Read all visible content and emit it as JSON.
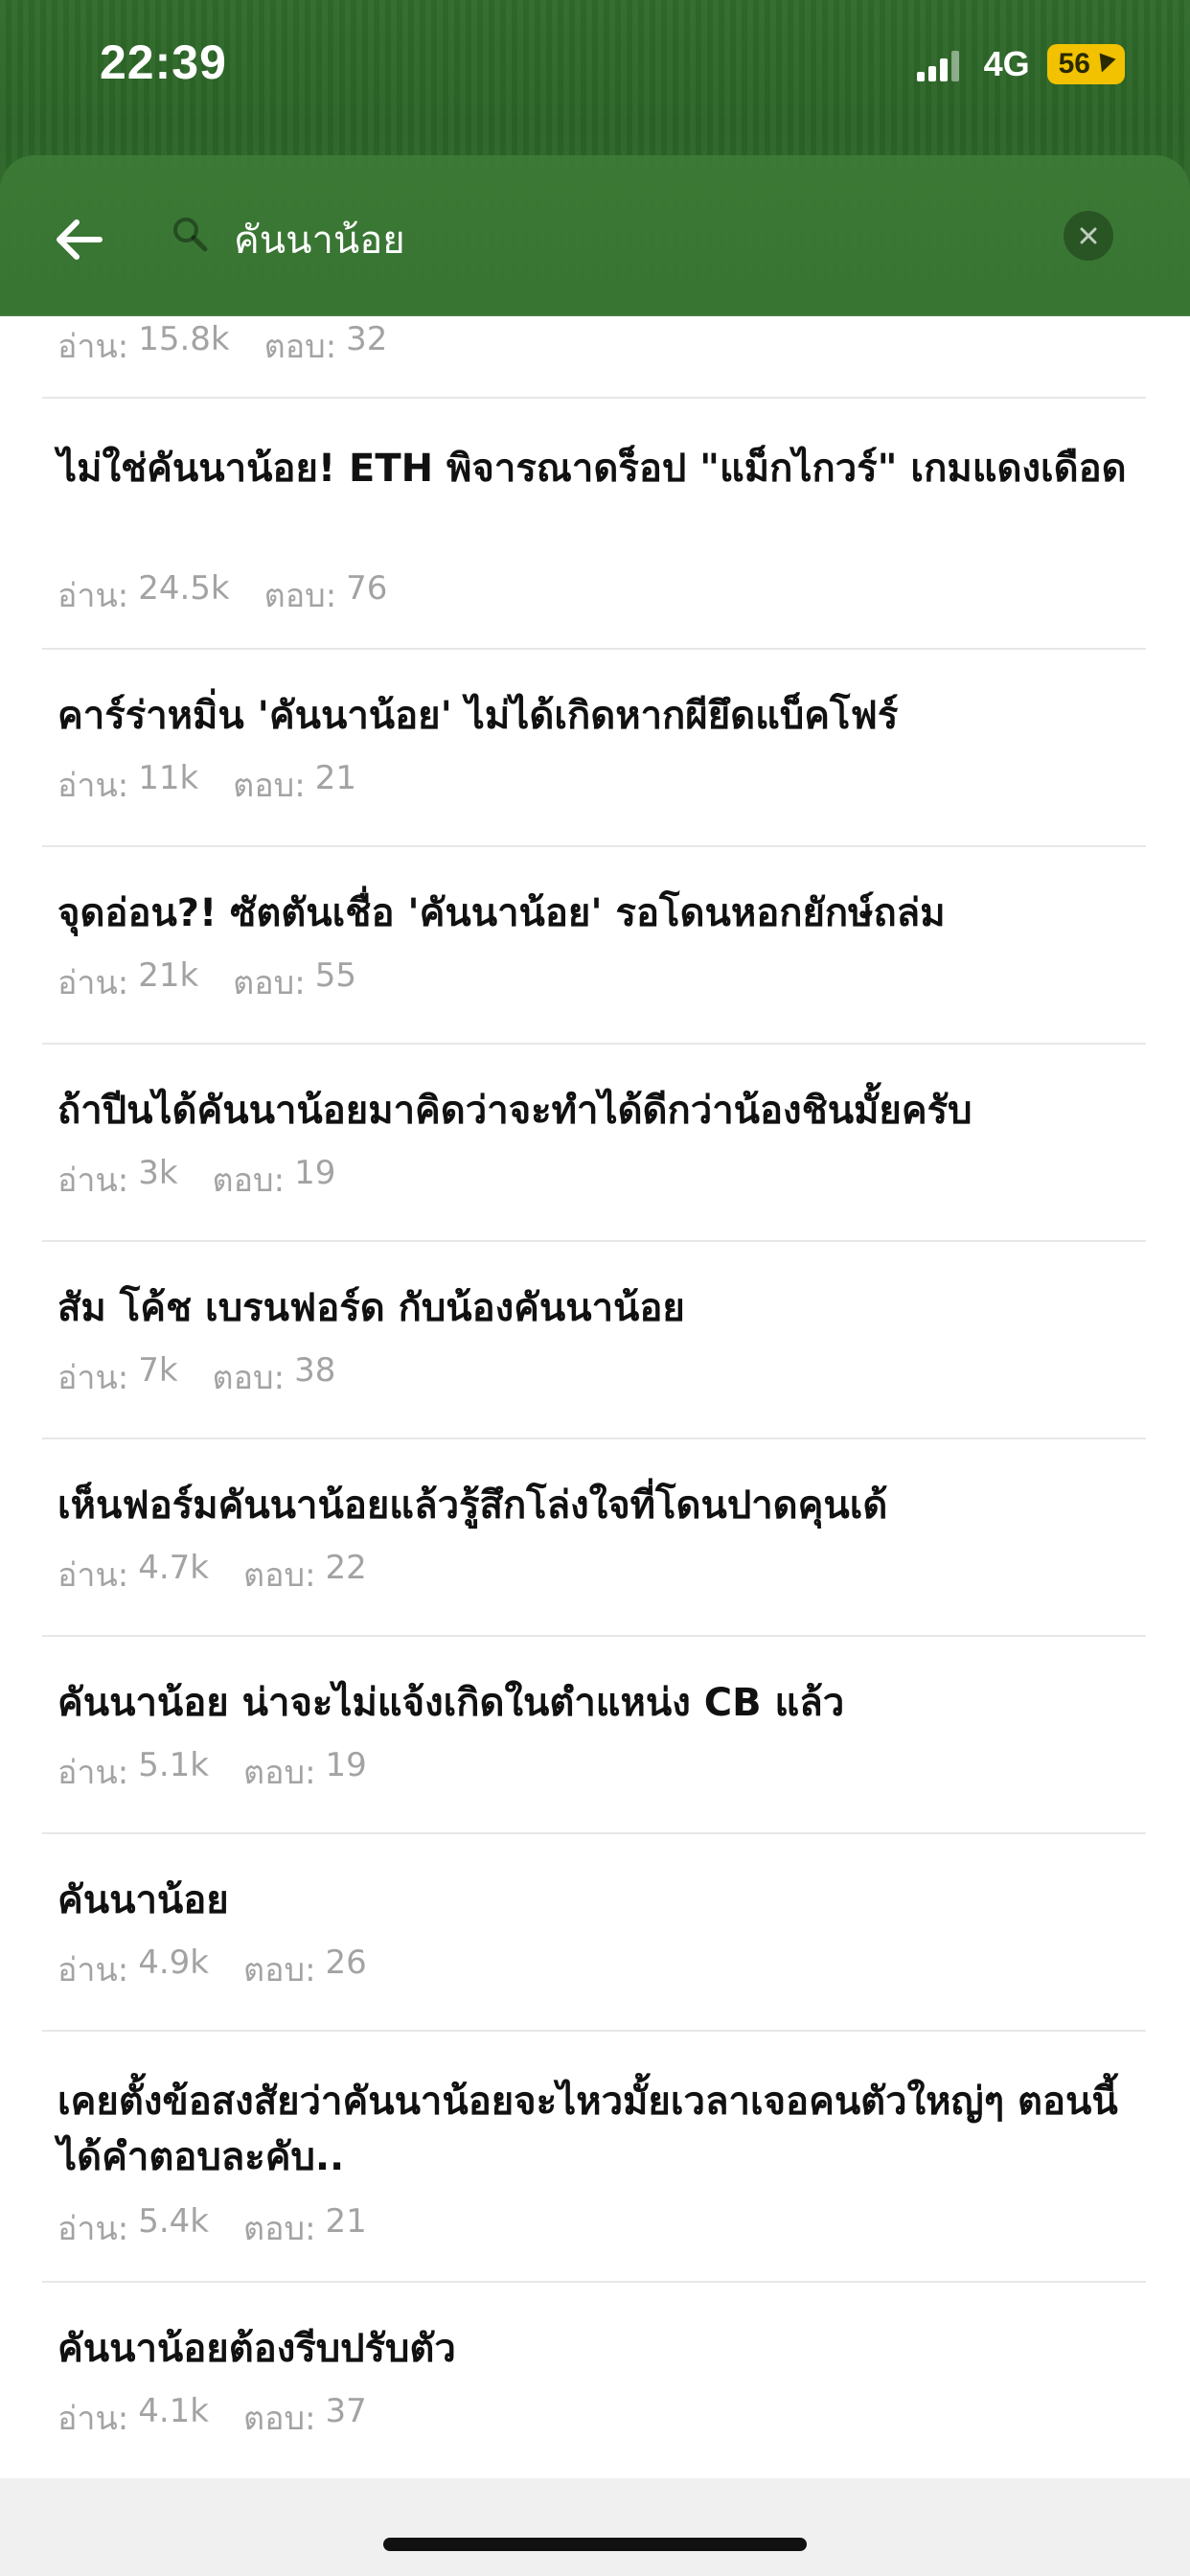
{
  "status": {
    "time": "22:39",
    "network": "4G",
    "battery": "56"
  },
  "search": {
    "query": "คันนาน้อย"
  },
  "meta_labels": {
    "read": "อ่าน:",
    "reply": "ตอบ:"
  },
  "results": [
    {
      "title": "",
      "read": "15.8k",
      "reply": "32"
    },
    {
      "title": "ไม่ใช่คันนาน้อย! ETH พิจารณาดร็อป \"แม็กไกวร์\" เกมแดงเดือด",
      "read": "24.5k",
      "reply": "76"
    },
    {
      "title": "คาร์ร่าหมิ่น 'คันนาน้อย' ไม่ได้เกิดหากผียึดแบ็คโฟร์",
      "read": "11k",
      "reply": "21"
    },
    {
      "title": "จุดอ่อน?! ซัตตันเชื่อ 'คันนาน้อย' รอโดนหอกยักษ์ถล่ม",
      "read": "21k",
      "reply": "55"
    },
    {
      "title": "ถ้าปีนได้คันนาน้อยมาคิดว่าจะทำได้ดีกว่าน้องชินมั้ยครับ",
      "read": "3k",
      "reply": "19"
    },
    {
      "title": "สัม โค้ช เบรนฟอร์ด กับน้องคันนาน้อย",
      "read": "7k",
      "reply": "38"
    },
    {
      "title": "เห็นฟอร์มคันนาน้อยแล้วรู้สึกโล่งใจที่โดนปาดคุนเด้",
      "read": "4.7k",
      "reply": "22"
    },
    {
      "title": "คันนาน้อย น่าจะไม่แจ้งเกิดในตำแหน่ง CB แล้ว",
      "read": "5.1k",
      "reply": "19"
    },
    {
      "title": "คันนาน้อย",
      "read": "4.9k",
      "reply": "26"
    },
    {
      "title": "เคยตั้งข้อสงสัยว่าคันนาน้อยจะไหวมั้ยเวลาเจอคนตัวใหญ่ๆ ตอนนี้ได้คำตอบละคับ..",
      "read": "5.4k",
      "reply": "21"
    },
    {
      "title": "คันนาน้อยต้องรีบปรับตัว",
      "read": "4.1k",
      "reply": "37"
    }
  ]
}
